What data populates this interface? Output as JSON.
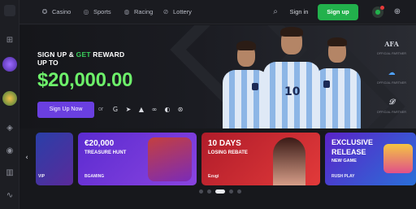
{
  "nav": {
    "items": [
      {
        "label": "Casino",
        "icon": "casino-chip-icon"
      },
      {
        "label": "Sports",
        "icon": "sports-ball-icon"
      },
      {
        "label": "Racing",
        "icon": "racing-icon"
      },
      {
        "label": "Lottery",
        "icon": "lottery-icon"
      }
    ],
    "signin_label": "Sign in",
    "signup_label": "Sign up"
  },
  "hero": {
    "line1_a": "SIGN UP & ",
    "line1_b": "GET",
    "line1_c": " REWARD",
    "line2": "UP TO",
    "amount": "$20,000.00",
    "cta_label": "Sign Up Now",
    "or_label": "or",
    "jersey_numbers": [
      "10",
      ""
    ]
  },
  "partners": [
    {
      "logo": "AFA",
      "caption": "OFFICIAL PARTNER"
    },
    {
      "logo": "cloud",
      "caption": "OFFICIAL PARTNER"
    },
    {
      "logo": "sig",
      "caption": "OFFICIAL PARTNER"
    }
  ],
  "promos": [
    {
      "line1": "",
      "line2": "",
      "brand": "EVOLUTION"
    },
    {
      "line1": "€20,000",
      "line2": "TREASURE HUNT",
      "brand": "BGAMING"
    },
    {
      "line1": "10 DAYS",
      "line2": "LOSING REBATE",
      "brand": "Ezugi"
    },
    {
      "line1": "EXCLUSIVE",
      "line1b": "RELEASE",
      "line2": "NEW GAME",
      "brand": "RUSH PLAY"
    }
  ],
  "colors": {
    "accent_green": "#22b14c",
    "amount_green": "#6df06a",
    "cta_purple": "#6a3fe0"
  },
  "carousel": {
    "active_index": 2,
    "count": 6
  }
}
